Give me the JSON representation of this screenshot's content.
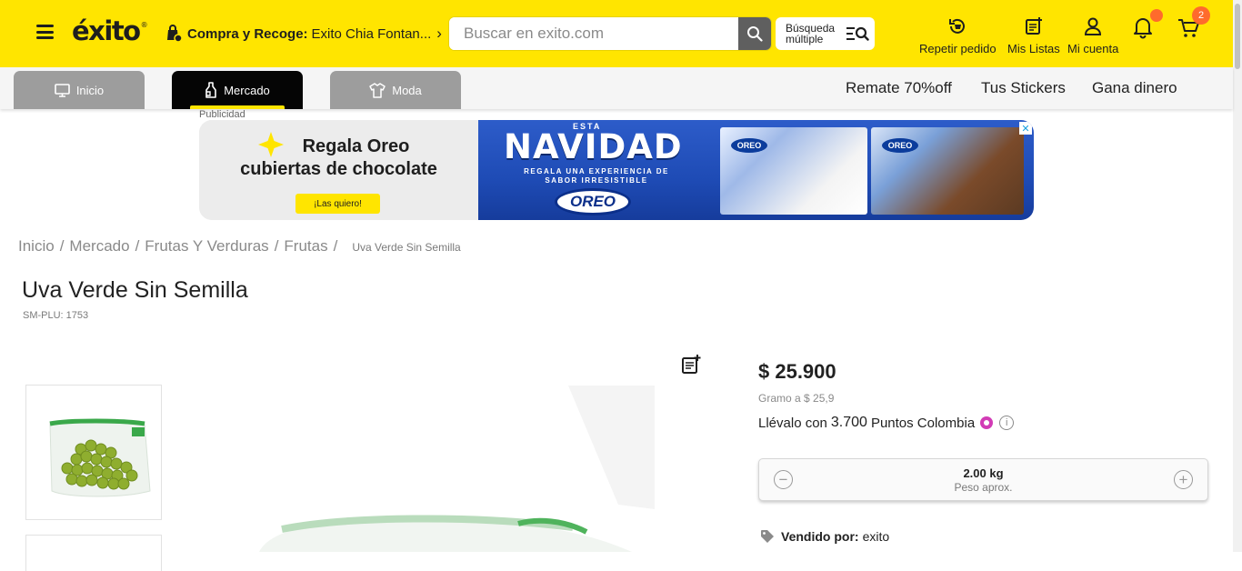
{
  "header": {
    "logo": "éxito",
    "store_prefix": "Compra y Recoge:",
    "store_name": "Exito Chia Fontan...",
    "search": {
      "placeholder": "Buscar en exito.com"
    },
    "multi_search": "Búsqueda múltiple",
    "repeat_order": "Repetir pedido",
    "my_lists": "Mis Listas",
    "my_account": "Mi cuenta",
    "cart_count": "2",
    "brand_color": "#ffe500"
  },
  "nav": {
    "tabs": [
      {
        "label": "Inicio",
        "icon": "monitor-icon"
      },
      {
        "label": "Mercado",
        "icon": "bottle-icon"
      },
      {
        "label": "Moda",
        "icon": "shirt-icon"
      }
    ],
    "links": [
      "Remate 70%off",
      "Tus Stickers",
      "Gana dinero"
    ]
  },
  "ad": {
    "label": "Publicidad",
    "line1": "Regala Oreo",
    "line2": "cubiertas de chocolate",
    "cta": "¡Las quiero!",
    "esta": "ESTA",
    "headline": "NAVIDAD",
    "subline": "REGALA UNA EXPERIENCIA DE SABOR IRRESISTIBLE",
    "brand": "OREO"
  },
  "breadcrumb": [
    "Inicio",
    "Mercado",
    "Frutas Y Verduras",
    "Frutas"
  ],
  "breadcrumb_current": "Uva Verde Sin Semilla",
  "product": {
    "title": "Uva Verde Sin Semilla",
    "sku": "SM-PLU: 1753",
    "price": "$ 25.900",
    "unit_price": "Gramo a $ 25,9",
    "points_prefix": "Llévalo con",
    "points_value": "3.700",
    "points_suffix": "Puntos Colombia",
    "quantity": "2.00 kg",
    "quantity_note": "Peso aprox.",
    "seller_label": "Vendido por:",
    "seller": "exito"
  }
}
